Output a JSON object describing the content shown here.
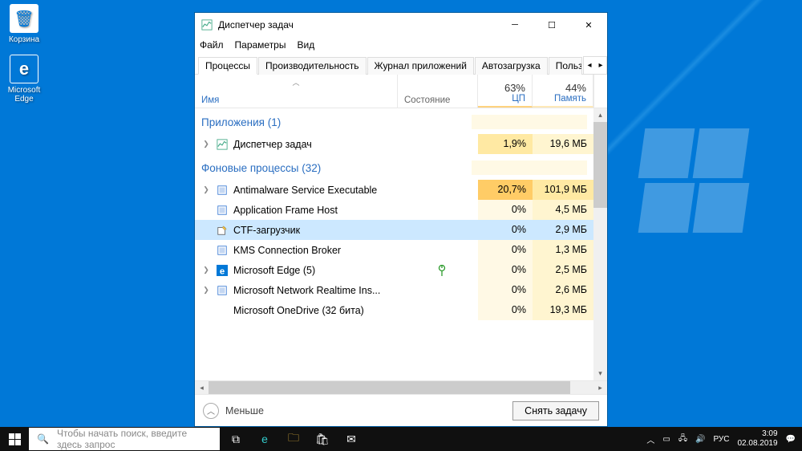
{
  "desktop": {
    "recycle_bin": "Корзина",
    "edge": "Microsoft Edge"
  },
  "window": {
    "title": "Диспетчер задач",
    "menu": {
      "file": "Файл",
      "options": "Параметры",
      "view": "Вид"
    },
    "tabs": {
      "processes": "Процессы",
      "performance": "Производительность",
      "app_history": "Журнал приложений",
      "startup": "Автозагрузка",
      "users": "Пользователи"
    },
    "headers": {
      "name": "Имя",
      "state": "Состояние",
      "cpu_pct": "63%",
      "cpu": "ЦП",
      "mem_pct": "44%",
      "mem": "Память"
    },
    "groups": {
      "apps": "Приложения (1)",
      "bg": "Фоновые процессы (32)"
    },
    "rows": {
      "taskmgr": {
        "name": "Диспетчер задач",
        "cpu": "1,9%",
        "mem": "19,6 МБ"
      },
      "antimalware": {
        "name": "Antimalware Service Executable",
        "cpu": "20,7%",
        "mem": "101,9 МБ"
      },
      "appframe": {
        "name": "Application Frame Host",
        "cpu": "0%",
        "mem": "4,5 МБ"
      },
      "ctf": {
        "name": "CTF-загрузчик",
        "cpu": "0%",
        "mem": "2,9 МБ"
      },
      "kms": {
        "name": "KMS Connection Broker",
        "cpu": "0%",
        "mem": "1,3 МБ"
      },
      "edge": {
        "name": "Microsoft Edge (5)",
        "cpu": "0%",
        "mem": "2,5 МБ"
      },
      "netrt": {
        "name": "Microsoft Network Realtime Ins...",
        "cpu": "0%",
        "mem": "2,6 МБ"
      },
      "onedrive": {
        "name": "Microsoft OneDrive (32 бита)",
        "cpu": "0%",
        "mem": "19,3 МБ"
      }
    },
    "footer": {
      "fewer": "Меньше",
      "end_task": "Снять задачу"
    }
  },
  "taskbar": {
    "search_placeholder": "Чтобы начать поиск, введите здесь запрос",
    "lang": "РУС",
    "time": "3:09",
    "date": "02.08.2019"
  }
}
